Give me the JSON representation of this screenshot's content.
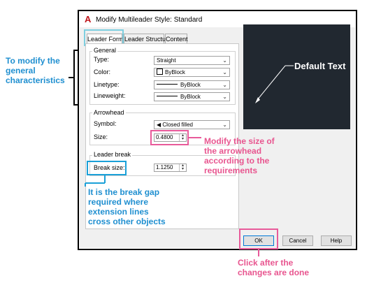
{
  "dialog": {
    "title": "Modify Multileader Style: Standard",
    "app_icon": "A"
  },
  "tabs": [
    {
      "label": "Leader Format"
    },
    {
      "label": "Leader Structure"
    },
    {
      "label": "Content"
    }
  ],
  "general": {
    "title": "General",
    "type_label": "Type:",
    "type_value": "Straight",
    "color_label": "Color:",
    "color_value": "ByBlock",
    "linetype_label": "Linetype:",
    "linetype_value": "ByBlock",
    "lineweight_label": "Lineweight:",
    "lineweight_value": "ByBlock"
  },
  "arrowhead": {
    "title": "Arrowhead",
    "symbol_label": "Symbol:",
    "symbol_value": "Closed filled",
    "size_label": "Size:",
    "size_value": "0.4800"
  },
  "leader_break": {
    "title": "Leader break",
    "break_size_label": "Break size:",
    "break_size_value": "1.1250"
  },
  "preview": {
    "text": "Default Text"
  },
  "buttons": {
    "ok": "OK",
    "cancel": "Cancel",
    "help": "Help"
  },
  "annotations": {
    "general": "To modify the\ngeneral\ncharacteristics",
    "arrowhead": "Modify the size of\nthe arrowhead\naccording to the\nrequirements",
    "break": "It is the break gap\nrequired where\nextension lines\ncross other objects",
    "ok": "Click after the\nchanges are done"
  },
  "colors": {
    "annotation_blue": "#1f8fd0",
    "annotation_pink": "#e8558f",
    "tab_highlight": "#7ecfe0",
    "preview_bg": "#212830"
  }
}
